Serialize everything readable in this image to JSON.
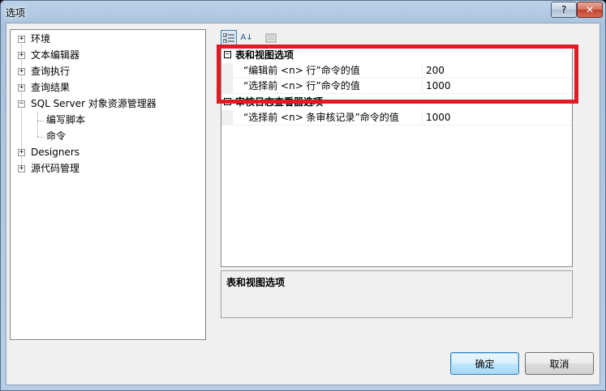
{
  "window": {
    "title": "选项",
    "help_label": "?",
    "close_label": "✕"
  },
  "tree": {
    "items": [
      {
        "label": "环境",
        "expander": "+"
      },
      {
        "label": "文本编辑器",
        "expander": "+"
      },
      {
        "label": "查询执行",
        "expander": "+"
      },
      {
        "label": "查询结果",
        "expander": "+"
      },
      {
        "label": "SQL Server 对象资源管理器",
        "expander": "−"
      },
      {
        "label": "编写脚本",
        "expander": ""
      },
      {
        "label": "命令",
        "expander": "",
        "selected": true
      },
      {
        "label": "Designers",
        "expander": "+"
      },
      {
        "label": "源代码管理",
        "expander": "+"
      }
    ]
  },
  "toolbar": {
    "categorized_icon": "categorized-icon",
    "alphabetical_icon": "alphabetical-icon",
    "alphabetical_label": "A↓",
    "property_pages_icon": "property-pages-icon"
  },
  "grid": {
    "categories": [
      {
        "label": "表和视图选项",
        "toggle": "−",
        "properties": [
          {
            "name": "“编辑前 <n> 行”命令的值",
            "value": "200"
          },
          {
            "name": "“选择前 <n> 行”命令的值",
            "value": "1000"
          }
        ]
      },
      {
        "label": "审核日志查看器选项",
        "toggle": "−",
        "properties": [
          {
            "name": "“选择前 <n> 条审核记录”命令的值",
            "value": "1000"
          }
        ]
      }
    ]
  },
  "description": {
    "title": "表和视图选项"
  },
  "buttons": {
    "ok": "确定",
    "cancel": "取消"
  },
  "colors": {
    "highlight": "#e01b24",
    "default_button": "#3c7fb1"
  }
}
